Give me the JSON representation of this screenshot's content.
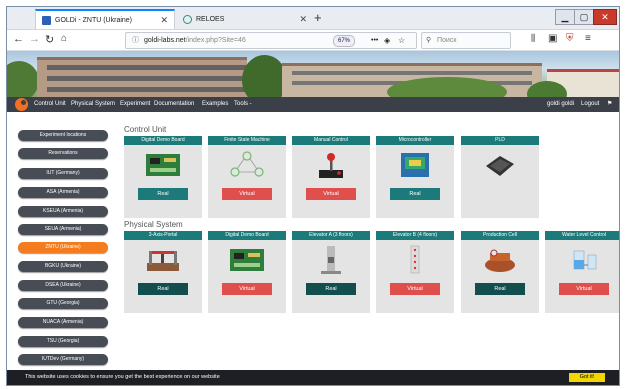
{
  "tabs": [
    {
      "title": "GOLDi - ZNTU (Ukraine)",
      "active": true
    },
    {
      "title": "RELOES",
      "active": false
    }
  ],
  "navbar": {
    "url_host": "goldi-labs.net",
    "url_path": "/index.php?Site=46",
    "zoom": "67%",
    "search_placeholder": "Поиск"
  },
  "menu": {
    "items": [
      "Control Unit",
      "Physical System",
      "Experiment",
      "Documentation",
      "Examples",
      "Tools -"
    ],
    "right": [
      "goldi goldi",
      "Logout"
    ]
  },
  "sidebar": {
    "items": [
      "Experiment locations",
      "Reservations",
      "IUT (Germany)",
      "ASA (Armenia)",
      "KSEUA (Armenia)",
      "SEUA (Armenia)",
      "ZNTU (Ukraine)",
      "BGKU (Ukraine)",
      "DSEA (Ukraine)",
      "GTU (Georgia)",
      "NUACA (Armenia)",
      "TSU (Georgia)",
      "IUTDev (Germany)"
    ],
    "active_index": 6
  },
  "control_unit": {
    "title": "Control Unit",
    "cards": [
      {
        "name": "Digital Demo Board",
        "button": "Real"
      },
      {
        "name": "Finite State Machine",
        "button": "Virtual"
      },
      {
        "name": "Manual Control",
        "button": "Virtual"
      },
      {
        "name": "Microcontroller",
        "button": "Real"
      },
      {
        "name": "PLD",
        "button": ""
      }
    ]
  },
  "physical_system": {
    "title": "Physical System",
    "cards": [
      {
        "name": "3-Axis-Portal",
        "button": "Real"
      },
      {
        "name": "Digital Demo Board",
        "button": "Virtual"
      },
      {
        "name": "Elevator A (3 floors)",
        "button": "Real"
      },
      {
        "name": "Elevator B (4 floors)",
        "button": "Virtual"
      },
      {
        "name": "Production Cell",
        "button": "Real"
      },
      {
        "name": "Water Level Control",
        "button": "Virtual"
      }
    ]
  },
  "cookie": {
    "message": "This website uses cookies to ensure you get the best experience on our website",
    "button": "Got it!"
  },
  "colors": {
    "accent_teal": "#1c7b7a",
    "virtual_red": "#df4f4c",
    "active_orange": "#f47c1e",
    "menu_dark": "#3b3f48"
  }
}
